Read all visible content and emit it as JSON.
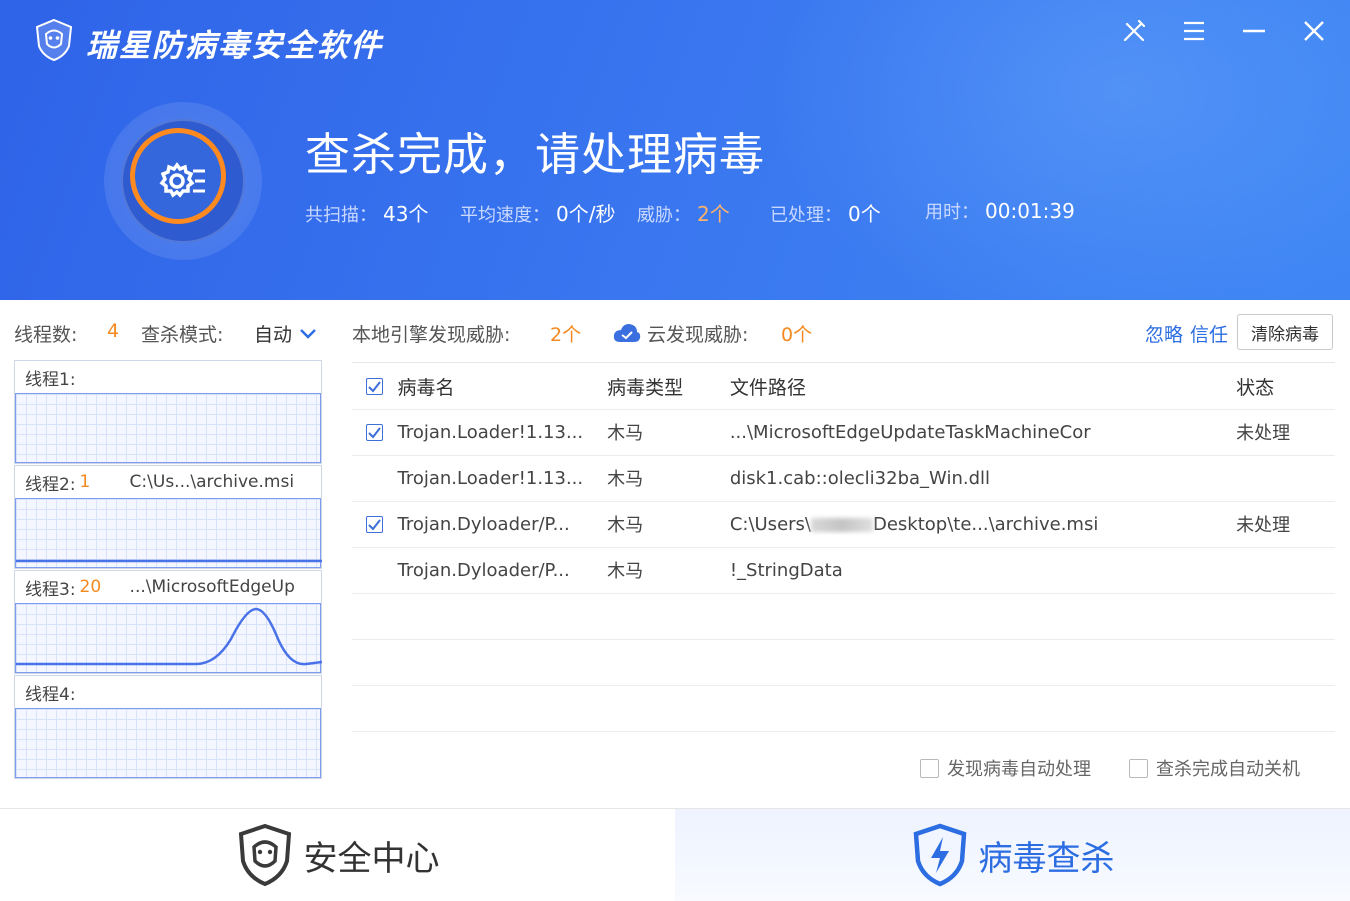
{
  "app": {
    "title": "瑞星防病毒安全软件"
  },
  "window_controls": [
    {
      "name": "tools-icon"
    },
    {
      "name": "menu-icon"
    },
    {
      "name": "minimize-icon"
    },
    {
      "name": "close-icon"
    }
  ],
  "scan_status": {
    "headline": "查杀完成，请处理病毒",
    "stats": [
      {
        "label": "共扫描：",
        "value": "43个"
      },
      {
        "label": "平均速度：",
        "value": "0个/秒"
      },
      {
        "label": "威胁：",
        "value": "2个"
      },
      {
        "label": "已处理：",
        "value": "0个"
      },
      {
        "label": "用时：",
        "value": "00:01:39"
      }
    ]
  },
  "toolbar": {
    "threads_label": "线程数:",
    "threads_value": "4",
    "mode_label": "查杀模式:",
    "mode_value": "自动",
    "local_label": "本地引擎发现威胁:",
    "local_value": "2个",
    "cloud_label": "云发现威胁:",
    "cloud_value": "0个",
    "ignore_label": "忽略",
    "trust_label": "信任",
    "clean_label": "清除病毒"
  },
  "threads": [
    {
      "label": "线程1:",
      "count": "",
      "path": ""
    },
    {
      "label": "线程2:",
      "count": "1",
      "path": "C:\\Us...\\archive.msi"
    },
    {
      "label": "线程3:",
      "count": "20",
      "path": "...\\MicrosoftEdgeUp"
    },
    {
      "label": "线程4:",
      "count": "",
      "path": ""
    }
  ],
  "table": {
    "headers": {
      "name": "病毒名",
      "type": "病毒类型",
      "path": "文件路径",
      "status": "状态"
    },
    "rows": [
      {
        "checked": true,
        "name": "Trojan.Loader!1.13...",
        "type": "木马",
        "path": "...\\MicrosoftEdgeUpdateTaskMachineCor",
        "status": "未处理"
      },
      {
        "checked": false,
        "name": "Trojan.Loader!1.13...",
        "type": "木马",
        "path": "disk1.cab::olecli32ba_Win.dll",
        "status": ""
      },
      {
        "checked": true,
        "name": "Trojan.Dyloader/P...",
        "type": "木马",
        "path_prefix": "C:\\Users\\",
        "path_suffix": "Desktop\\te...\\archive.msi",
        "status": "未处理"
      },
      {
        "checked": false,
        "name": "Trojan.Dyloader/P...",
        "type": "木马",
        "path": "!_StringData",
        "status": ""
      }
    ]
  },
  "options": {
    "auto_process": "发现病毒自动处理",
    "auto_shutdown": "查杀完成自动关机"
  },
  "bottom_tabs": {
    "security": "安全中心",
    "virus": "病毒查杀"
  },
  "colors": {
    "header_blue": "#3a78f0",
    "accent_orange": "#f5891f",
    "link_blue": "#2c6de2"
  }
}
